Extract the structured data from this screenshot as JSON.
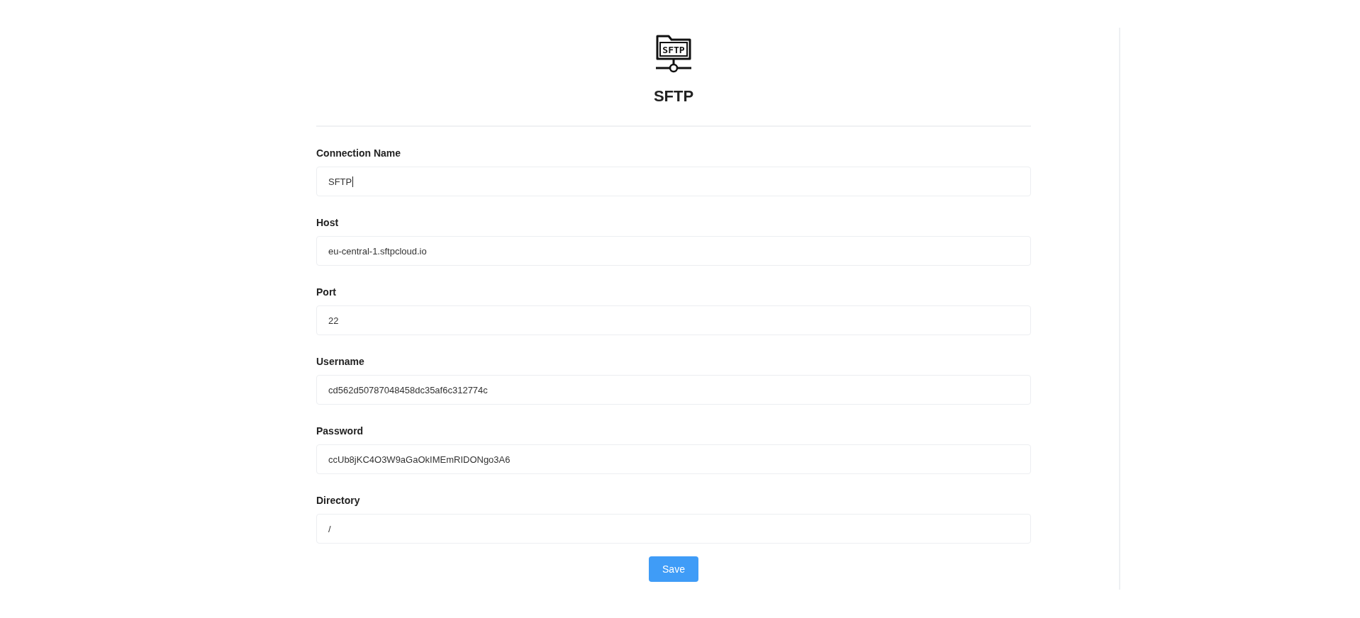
{
  "header": {
    "icon_label": "SFTP",
    "title": "SFTP"
  },
  "fields": [
    {
      "label": "Connection Name",
      "value": "SFTP",
      "focused": true
    },
    {
      "label": "Host",
      "value": "eu-central-1.sftpcloud.io",
      "focused": false
    },
    {
      "label": "Port",
      "value": "22",
      "focused": false
    },
    {
      "label": "Username",
      "value": "cd562d50787048458dc35af6c312774c",
      "focused": false
    },
    {
      "label": "Password",
      "value": "ccUb8jKC4O3W9aGaOkIMEmRIDONgo3A6",
      "focused": false
    },
    {
      "label": "Directory",
      "value": "/",
      "focused": false
    }
  ],
  "save_button": "Save"
}
